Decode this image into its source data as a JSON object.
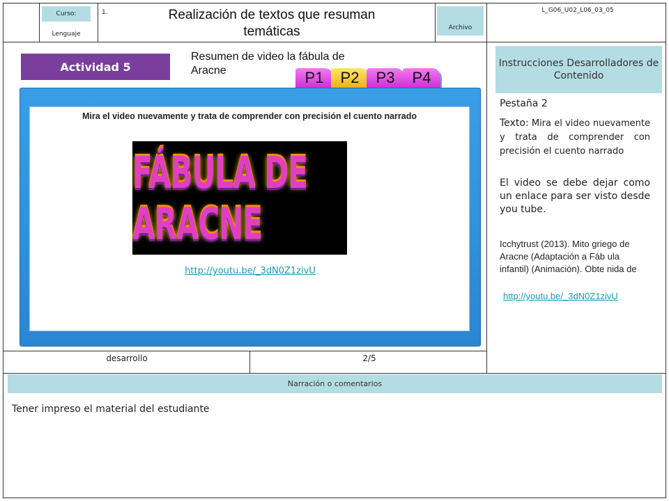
{
  "header": {
    "curso_label": "Curso:",
    "curso_value": "Lenguaje",
    "number": "1.",
    "title": "Realización de textos que resuman temáticas",
    "archivo_label": "Archivo",
    "code": "L_G06_U02_L06_03_05"
  },
  "activity": {
    "label": "Actividad 5",
    "subtitle": "Resumen de video la fábula de Aracne",
    "tabs": [
      {
        "label": "P1",
        "active": false
      },
      {
        "label": "P2",
        "active": true
      },
      {
        "label": "P3",
        "active": false
      },
      {
        "label": "P4",
        "active": false
      }
    ],
    "instruction": "Mira el video nuevamente y trata de comprender con precisión el cuento narrado",
    "video_title": "FÁBULA DE ARACNE",
    "video_link": "http://youtu.be/_3dN0Z1zivU"
  },
  "instructions_panel": {
    "heading": "Instrucciones Desarrolladores de Contenido",
    "tab_name": "Pestaña 2",
    "texto_label": "Texto:",
    "texto_body": " Mira el video nuevamente y trata de comprender con precisión el cuento narrado",
    "video_note": "El video se debe dejar como un enlace para ser visto desde you tube.",
    "citation": "Icchytrust (2013). Mito griego de Aracne (Adaptación a Fáb ula infantil) (Animación). Obte nida de",
    "citation_link": "http://youtu.be/_3dN0Z1zivU"
  },
  "footer": {
    "stage": "desarrollo",
    "page": "2/5",
    "narration_heading": "Narración o comentarios",
    "narration_text": "Tener impreso el material del estudiante"
  },
  "colors": {
    "header_cell": "#b3dde3",
    "activity_badge": "#7a3e9d",
    "panel_blue": "#2a86d2",
    "tab_pink": "#d12ed6",
    "tab_active_yellow": "#eab511",
    "link": "#1a9ab0"
  }
}
